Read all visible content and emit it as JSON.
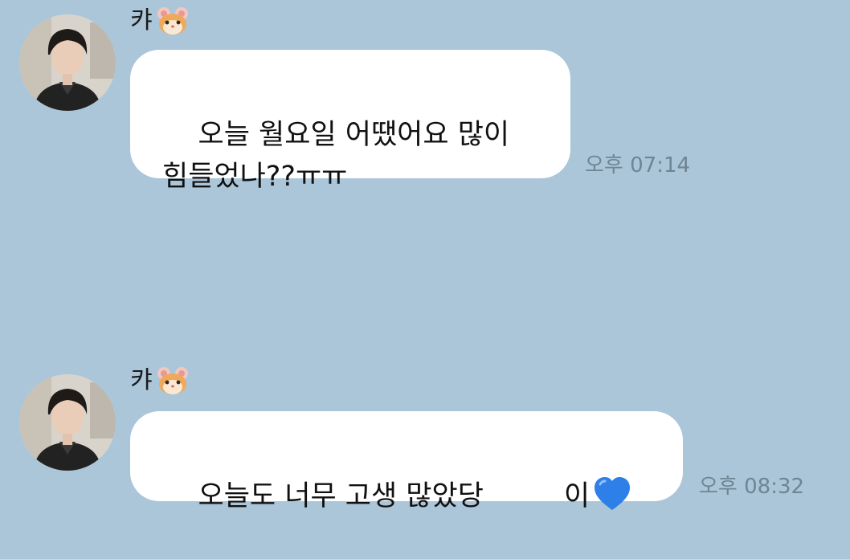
{
  "messages": [
    {
      "sender": "캬",
      "sender_emoji": "hamster-face",
      "text": "오늘 월요일 어땠어요 많이\n힘들었나??ㅠㅠ",
      "time": "오후 07:14"
    },
    {
      "sender": "캬",
      "sender_emoji": "hamster-face",
      "text_before": "오늘도 너무 고생 많았당",
      "text_after": "이",
      "trailing_emoji": "blue-heart",
      "time": "오후 08:32"
    }
  ],
  "colors": {
    "background": "#abc6d8",
    "bubble": "#ffffff",
    "time": "#6f8594",
    "heart": "#2f7fe8"
  }
}
